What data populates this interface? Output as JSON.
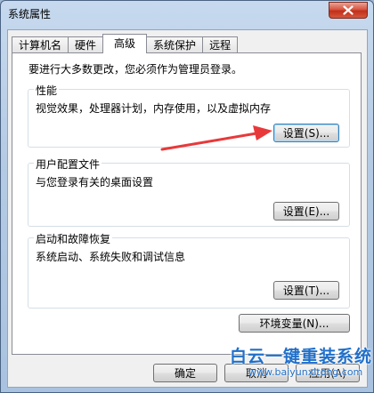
{
  "window": {
    "title": "系统属性"
  },
  "tabs": [
    {
      "label": "计算机名"
    },
    {
      "label": "硬件"
    },
    {
      "label": "高级"
    },
    {
      "label": "系统保护"
    },
    {
      "label": "远程"
    }
  ],
  "active_tab": "高级",
  "admin_note": "要进行大多数更改，您必须作为管理员登录。",
  "performance": {
    "title": "性能",
    "description": "视觉效果，处理器计划，内存使用，以及虚拟内存",
    "settings_button": "设置(S)..."
  },
  "user_profiles": {
    "title": "用户配置文件",
    "description": "与您登录有关的桌面设置",
    "settings_button": "设置(E)..."
  },
  "startup_recovery": {
    "title": "启动和故障恢复",
    "description": "系统启动、系统失败和调试信息",
    "settings_button": "设置(T)..."
  },
  "env_vars_button": "环境变量(N)...",
  "footer": {
    "ok_button": "确定",
    "cancel_button": "取消",
    "apply_button": "应用(A)"
  },
  "watermark": {
    "title": "白云一键重装系统",
    "url": "www.baiyunxitong.com"
  },
  "colors": {
    "arrow": "#e8393a",
    "watermark": "#1f6fc9",
    "close_button": "#c9402b"
  }
}
